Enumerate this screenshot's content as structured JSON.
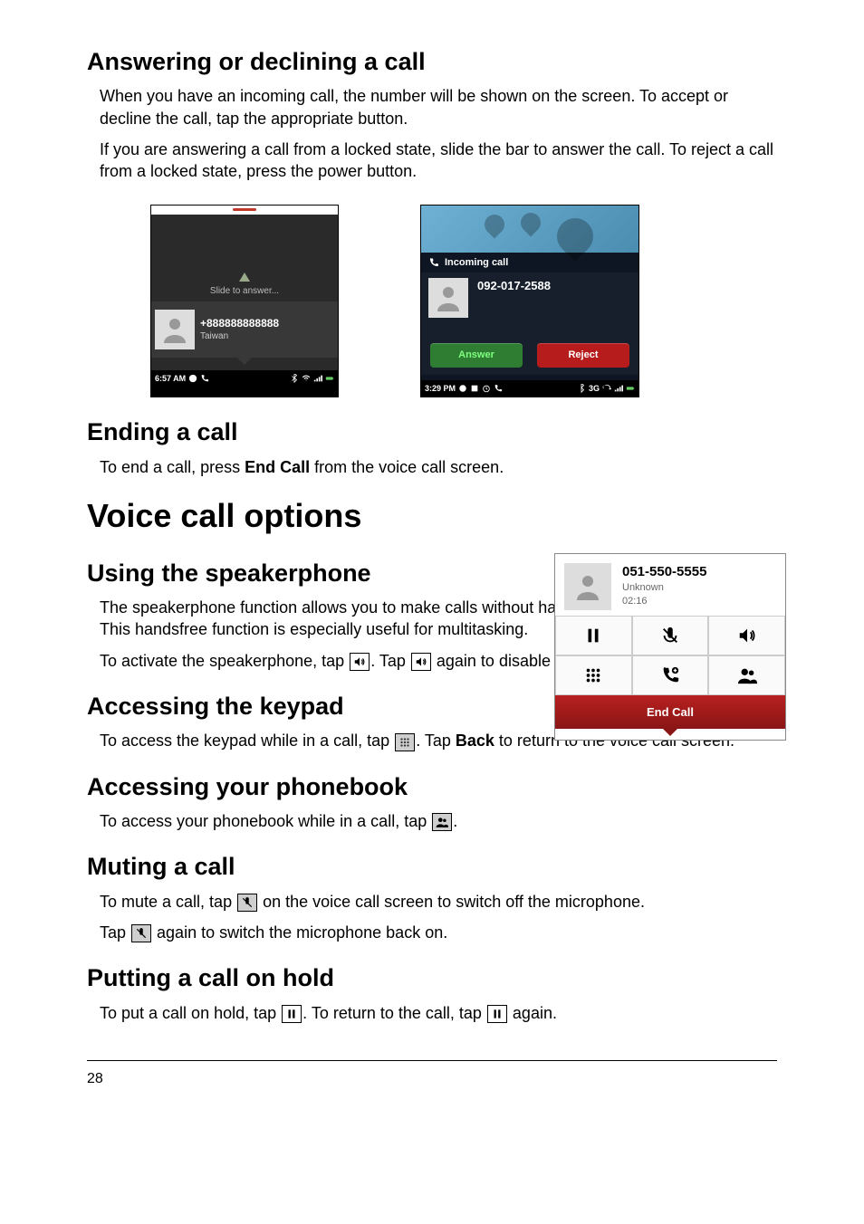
{
  "headings": {
    "answering": "Answering or declining a call",
    "ending": "Ending a call",
    "voice_options": "Voice call options",
    "speakerphone": "Using the speakerphone",
    "keypad": "Accessing the keypad",
    "phonebook": "Accessing your phonebook",
    "muting": "Muting a call",
    "hold": "Putting a call on hold"
  },
  "paras": {
    "answering1": "When you have an incoming call, the number will be shown on the screen. To accept or decline the call, tap the appropriate button.",
    "answering2": "If you are answering a call from a locked state, slide the bar to answer the call. To reject a call from a locked state, press the power button.",
    "ending1_a": "To end a call, press ",
    "ending1_bold": "End Call",
    "ending1_b": " from the voice call screen.",
    "speaker1": "The speakerphone function allows you to make calls without having to hold your smartphone. This handsfree function is especially useful for multitasking.",
    "speaker2_a": "To activate the speakerphone, tap ",
    "speaker2_b": ". Tap ",
    "speaker2_c": " again to disable the speakerphone.",
    "keypad_a": "To access the keypad while in a call, tap ",
    "keypad_b": ". Tap ",
    "keypad_bold": "Back",
    "keypad_c": " to return to the voice call screen.",
    "phonebook_a": "To access your phonebook while in a call, tap ",
    "phonebook_b": ".",
    "mute1_a": "To mute a call, tap ",
    "mute1_b": " on the voice call screen to switch off the microphone.",
    "mute2_a": "Tap ",
    "mute2_b": " again to switch the microphone back on.",
    "hold_a": "To put a call on hold, tap ",
    "hold_b": ". To return to the call, tap ",
    "hold_c": " again."
  },
  "locked_phone": {
    "slide_text": "Slide to answer...",
    "number": "+888888888888",
    "location": "Taiwan",
    "time": "6:57 AM"
  },
  "incoming_phone": {
    "title": "Incoming call",
    "number": "092-017-2588",
    "answer": "Answer",
    "reject": "Reject",
    "time": "3:29 PM",
    "net": "3G"
  },
  "incall_panel": {
    "number": "051-550-5555",
    "unknown": "Unknown",
    "timer": "02:16",
    "end": "End Call"
  },
  "page_number": "28"
}
